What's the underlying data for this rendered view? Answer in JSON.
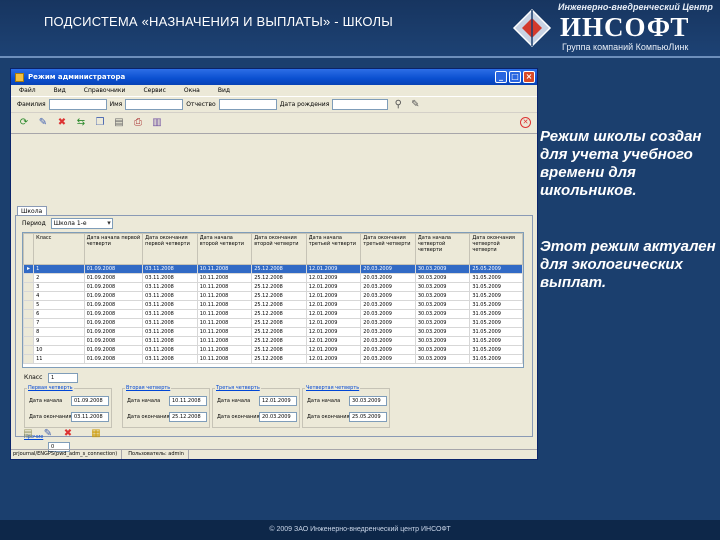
{
  "slide": {
    "title": "ПОДСИСТЕМА «НАЗНАЧЕНИЯ И ВЫПЛАТЫ» - ШКОЛЫ",
    "footer": "© 2009 ЗАО Инженерно-внедренческий центр ИНСОФТ",
    "description_1": "Режим школы создан для учета учебного времени для школьников.",
    "description_2": "Этот режим актуален для экологических выплат.",
    "colors": {
      "background": "#1b3f6e",
      "window_title": "#0a4fd0",
      "selection": "#316ac5"
    }
  },
  "logo": {
    "top": "Инженерно-внедренческий Центр",
    "main": "ИНСОФТ",
    "sub": "Группа компаний КомпьюЛинк"
  },
  "window": {
    "title": "Режим администратора",
    "menu": [
      "Файл",
      "Вид",
      "Справочники",
      "Сервис",
      "Окна",
      "Вид"
    ],
    "filters": [
      {
        "label": "Фамилия",
        "value": ""
      },
      {
        "label": "Имя",
        "value": ""
      },
      {
        "label": "Отчество",
        "value": ""
      },
      {
        "label": "Дата рождения",
        "value": ""
      }
    ],
    "toolbar_icons": [
      "refresh-icon",
      "edit-icon",
      "delete-icon",
      "export-icon",
      "copy-icon",
      "doc-icon",
      "print-icon",
      "book-icon"
    ],
    "tab_label": "Школа",
    "period_label": "Период",
    "period_value": "Школа 1-е",
    "columns": [
      "Класс",
      "Дата начала первой четверти",
      "Дата окончания первой четверти",
      "Дата начала второй четверти",
      "Дата окончания второй четверти",
      "Дата начала третьей четверти",
      "Дата окончания третьей четверти",
      "Дата начала четвертой четверти",
      "Дата окончания четвертой четверти"
    ],
    "rows": [
      [
        "1",
        "01.09.2008",
        "03.11.2008",
        "10.11.2008",
        "25.12.2008",
        "12.01.2009",
        "20.03.2009",
        "30.03.2009",
        "25.05.2009"
      ],
      [
        "2",
        "01.09.2008",
        "03.11.2008",
        "10.11.2008",
        "25.12.2008",
        "12.01.2009",
        "20.03.2009",
        "30.03.2009",
        "31.05.2009"
      ],
      [
        "3",
        "01.09.2008",
        "03.11.2008",
        "10.11.2008",
        "25.12.2008",
        "12.01.2009",
        "20.03.2009",
        "30.03.2009",
        "31.05.2009"
      ],
      [
        "4",
        "01.09.2008",
        "03.11.2008",
        "10.11.2008",
        "25.12.2008",
        "12.01.2009",
        "20.03.2009",
        "30.03.2009",
        "31.05.2009"
      ],
      [
        "5",
        "01.09.2008",
        "03.11.2008",
        "10.11.2008",
        "25.12.2008",
        "12.01.2009",
        "20.03.2009",
        "30.03.2009",
        "31.05.2009"
      ],
      [
        "6",
        "01.09.2008",
        "03.11.2008",
        "10.11.2008",
        "25.12.2008",
        "12.01.2009",
        "20.03.2009",
        "30.03.2009",
        "31.05.2009"
      ],
      [
        "7",
        "01.09.2008",
        "03.11.2008",
        "10.11.2008",
        "25.12.2008",
        "12.01.2009",
        "20.03.2009",
        "30.03.2009",
        "31.05.2009"
      ],
      [
        "8",
        "01.09.2008",
        "03.11.2008",
        "10.11.2008",
        "25.12.2008",
        "12.01.2009",
        "20.03.2009",
        "30.03.2009",
        "31.05.2009"
      ],
      [
        "9",
        "01.09.2008",
        "03.11.2008",
        "10.11.2008",
        "25.12.2008",
        "12.01.2009",
        "20.03.2009",
        "30.03.2009",
        "31.05.2009"
      ],
      [
        "10",
        "01.09.2008",
        "03.11.2008",
        "10.11.2008",
        "25.12.2008",
        "12.01.2009",
        "20.03.2009",
        "30.03.2009",
        "31.05.2009"
      ],
      [
        "11",
        "01.09.2008",
        "03.11.2008",
        "10.11.2008",
        "25.12.2008",
        "12.01.2009",
        "20.03.2009",
        "30.03.2009",
        "31.05.2009"
      ]
    ],
    "class_label": "Класс",
    "class_value": "1",
    "quarters": [
      {
        "title": "Первая четверть",
        "start_label": "Дата начала",
        "start": "01.09.2008",
        "end_label": "Дата окончания",
        "end": "03.11.2008"
      },
      {
        "title": "Вторая четверть",
        "start_label": "Дата начала",
        "start": "10.11.2008",
        "end_label": "Дата окончания",
        "end": "25.12.2008"
      },
      {
        "title": "Третья четверть",
        "start_label": "Дата начала",
        "start": "12.01.2009",
        "end_label": "Дата окончания",
        "end": "20.03.2009"
      },
      {
        "title": "Четвертая четверть",
        "start_label": "Дата начала",
        "start": "30.03.2009",
        "end_label": "Дата окончания",
        "end": "25.05.2009"
      }
    ],
    "extra_section": "Прочие",
    "extra_value": "0",
    "status": [
      "prjournal/ENGPS(pwd_adm_s_connection)",
      "Пользователь: admin"
    ]
  }
}
